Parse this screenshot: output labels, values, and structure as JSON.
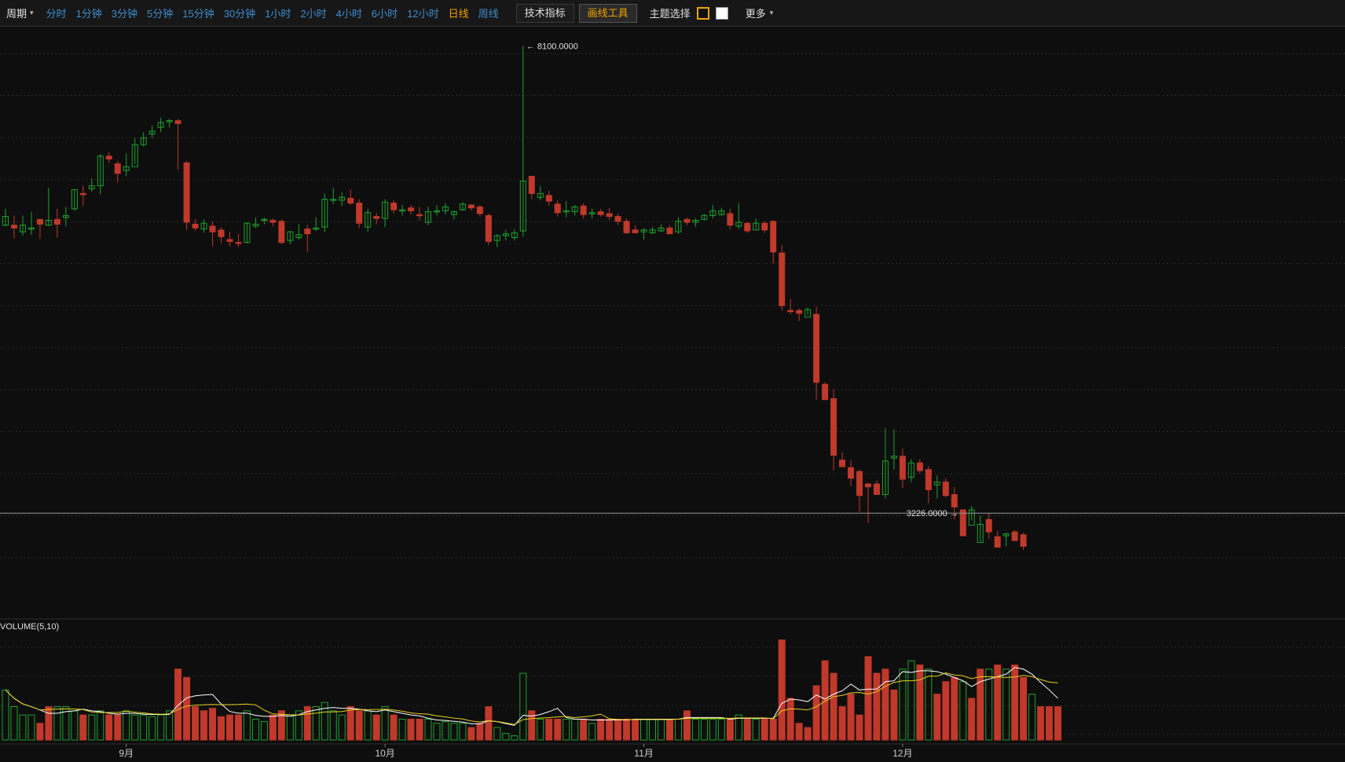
{
  "toolbar": {
    "period_label": "周期",
    "caret": "▾",
    "intervals": [
      "分时",
      "1分钟",
      "3分钟",
      "5分钟",
      "15分钟",
      "30分钟",
      "1小时",
      "2小时",
      "4小时",
      "6小时",
      "12小时",
      "日线",
      "周线"
    ],
    "active_interval": "日线",
    "indicators_label": "技术指标",
    "drawing_tools_label": "画线工具",
    "theme_label": "主题选择",
    "more_label": "更多"
  },
  "colors": {
    "up": "#1fa32e",
    "down": "#c0392b",
    "ma5": "#ffffff",
    "ma10": "#e8d21e",
    "accent": "#f0a500",
    "link": "#3d8fd1"
  },
  "chart_data": {
    "type": "candlestick",
    "price_ylim": [
      2400,
      8300
    ],
    "high_annotation": "8100.0000",
    "low_annotation": "3226.0000",
    "volume_label": "VOLUME(5,10)",
    "month_labels": [
      {
        "index": 14,
        "label": "9月"
      },
      {
        "index": 44,
        "label": "10月"
      },
      {
        "index": 74,
        "label": "11月"
      },
      {
        "index": 104,
        "label": "12月"
      }
    ],
    "candles": [
      [
        6320,
        6400,
        6220,
        6230,
        "up"
      ],
      [
        6200,
        6330,
        6090,
        6230,
        "down"
      ],
      [
        6230,
        6330,
        6120,
        6160,
        "up"
      ],
      [
        6190,
        6370,
        6130,
        6200,
        "up"
      ],
      [
        6240,
        6260,
        6090,
        6290,
        "down"
      ],
      [
        6230,
        6620,
        6220,
        6280,
        "up"
      ],
      [
        6240,
        6400,
        6100,
        6290,
        "down"
      ],
      [
        6330,
        6420,
        6220,
        6310,
        "up"
      ],
      [
        6400,
        6600,
        6380,
        6600,
        "up"
      ],
      [
        6560,
        6640,
        6430,
        6550,
        "down"
      ],
      [
        6610,
        6720,
        6580,
        6640,
        "up"
      ],
      [
        6950,
        6970,
        6550,
        6640,
        "up"
      ],
      [
        6920,
        6990,
        6880,
        6950,
        "down"
      ],
      [
        6770,
        6900,
        6680,
        6870,
        "down"
      ],
      [
        6840,
        6980,
        6740,
        6800,
        "up"
      ],
      [
        7070,
        7140,
        6870,
        6840,
        "up"
      ],
      [
        7140,
        7200,
        7050,
        7070,
        "up"
      ],
      [
        7210,
        7270,
        7140,
        7180,
        "up"
      ],
      [
        7300,
        7350,
        7200,
        7250,
        "up"
      ],
      [
        7320,
        7340,
        7250,
        7310,
        "up"
      ],
      [
        7320,
        7340,
        6810,
        7290,
        "down"
      ],
      [
        6880,
        6900,
        6180,
        6260,
        "down"
      ],
      [
        6200,
        6290,
        6170,
        6240,
        "down"
      ],
      [
        6250,
        6290,
        6150,
        6190,
        "up"
      ],
      [
        6220,
        6270,
        6010,
        6160,
        "down"
      ],
      [
        6180,
        6210,
        6040,
        6110,
        "down"
      ],
      [
        6080,
        6160,
        6010,
        6060,
        "down"
      ],
      [
        6050,
        6140,
        6000,
        6040,
        "down"
      ],
      [
        6050,
        6260,
        6040,
        6250,
        "up"
      ],
      [
        6240,
        6310,
        6200,
        6220,
        "up"
      ],
      [
        6280,
        6310,
        6240,
        6290,
        "up"
      ],
      [
        6280,
        6300,
        6220,
        6260,
        "down"
      ],
      [
        6270,
        6290,
        6030,
        6050,
        "down"
      ],
      [
        6070,
        6170,
        6030,
        6160,
        "up"
      ],
      [
        6130,
        6240,
        6080,
        6100,
        "up"
      ],
      [
        6190,
        6230,
        5950,
        6140,
        "down"
      ],
      [
        6200,
        6310,
        6170,
        6200,
        "up"
      ],
      [
        6500,
        6560,
        6160,
        6210,
        "up"
      ],
      [
        6500,
        6620,
        6450,
        6490,
        "up"
      ],
      [
        6490,
        6570,
        6430,
        6520,
        "up"
      ],
      [
        6510,
        6600,
        6440,
        6460,
        "down"
      ],
      [
        6460,
        6500,
        6200,
        6250,
        "down"
      ],
      [
        6210,
        6400,
        6160,
        6360,
        "up"
      ],
      [
        6320,
        6360,
        6240,
        6300,
        "down"
      ],
      [
        6300,
        6500,
        6210,
        6470,
        "up"
      ],
      [
        6460,
        6490,
        6350,
        6390,
        "down"
      ],
      [
        6390,
        6440,
        6330,
        6380,
        "up"
      ],
      [
        6410,
        6440,
        6340,
        6380,
        "down"
      ],
      [
        6340,
        6420,
        6280,
        6330,
        "down"
      ],
      [
        6260,
        6420,
        6230,
        6370,
        "up"
      ],
      [
        6370,
        6440,
        6330,
        6380,
        "up"
      ],
      [
        6420,
        6460,
        6340,
        6380,
        "up"
      ],
      [
        6370,
        6380,
        6290,
        6340,
        "up"
      ],
      [
        6450,
        6470,
        6380,
        6390,
        "up"
      ],
      [
        6440,
        6450,
        6380,
        6410,
        "down"
      ],
      [
        6420,
        6440,
        6320,
        6350,
        "down"
      ],
      [
        6330,
        6350,
        6020,
        6060,
        "down"
      ],
      [
        6120,
        6140,
        6000,
        6070,
        "up"
      ],
      [
        6140,
        6180,
        6070,
        6120,
        "up"
      ],
      [
        6150,
        6190,
        6070,
        6100,
        "up"
      ],
      [
        6690,
        8100,
        6110,
        6170,
        "up"
      ],
      [
        6740,
        6740,
        6500,
        6560,
        "down"
      ],
      [
        6560,
        6640,
        6490,
        6520,
        "up"
      ],
      [
        6540,
        6590,
        6430,
        6480,
        "down"
      ],
      [
        6450,
        6490,
        6320,
        6360,
        "down"
      ],
      [
        6380,
        6480,
        6310,
        6370,
        "up"
      ],
      [
        6420,
        6440,
        6330,
        6370,
        "up"
      ],
      [
        6430,
        6460,
        6300,
        6340,
        "down"
      ],
      [
        6360,
        6400,
        6300,
        6360,
        "up"
      ],
      [
        6370,
        6400,
        6320,
        6340,
        "down"
      ],
      [
        6350,
        6410,
        6280,
        6320,
        "down"
      ],
      [
        6320,
        6350,
        6230,
        6270,
        "down"
      ],
      [
        6270,
        6300,
        6140,
        6150,
        "down"
      ],
      [
        6180,
        6230,
        6150,
        6150,
        "down"
      ],
      [
        6180,
        6200,
        6080,
        6160,
        "up"
      ],
      [
        6180,
        6210,
        6140,
        6150,
        "up"
      ],
      [
        6200,
        6240,
        6160,
        6170,
        "up"
      ],
      [
        6200,
        6230,
        6180,
        6140,
        "down"
      ],
      [
        6270,
        6310,
        6140,
        6160,
        "up"
      ],
      [
        6290,
        6310,
        6230,
        6260,
        "down"
      ],
      [
        6280,
        6300,
        6210,
        6260,
        "up"
      ],
      [
        6330,
        6350,
        6280,
        6290,
        "up"
      ],
      [
        6380,
        6440,
        6300,
        6330,
        "up"
      ],
      [
        6380,
        6410,
        6330,
        6340,
        "up"
      ],
      [
        6350,
        6400,
        6190,
        6230,
        "down"
      ],
      [
        6260,
        6460,
        6190,
        6220,
        "up"
      ],
      [
        6250,
        6260,
        6150,
        6170,
        "down"
      ],
      [
        6250,
        6300,
        6190,
        6180,
        "up"
      ],
      [
        6250,
        6270,
        6150,
        6180,
        "down"
      ],
      [
        6270,
        6280,
        5830,
        5950,
        "down"
      ],
      [
        5940,
        6020,
        5340,
        5390,
        "down"
      ],
      [
        5340,
        5460,
        5300,
        5340,
        "down"
      ],
      [
        5340,
        5360,
        5230,
        5310,
        "down"
      ],
      [
        5350,
        5370,
        5290,
        5270,
        "up"
      ],
      [
        5300,
        5380,
        4410,
        4590,
        "down"
      ],
      [
        4570,
        4590,
        4410,
        4410,
        "down"
      ],
      [
        4420,
        4520,
        3670,
        3830,
        "down"
      ],
      [
        3780,
        3860,
        3710,
        3710,
        "down"
      ],
      [
        3700,
        3780,
        3510,
        3590,
        "down"
      ],
      [
        3660,
        3680,
        3240,
        3410,
        "down"
      ],
      [
        3500,
        3540,
        3120,
        3530,
        "down"
      ],
      [
        3530,
        3570,
        3480,
        3420,
        "down"
      ],
      [
        3770,
        4110,
        3380,
        3420,
        "up"
      ],
      [
        3820,
        4100,
        3680,
        3800,
        "up"
      ],
      [
        3820,
        3900,
        3490,
        3580,
        "down"
      ],
      [
        3600,
        3790,
        3550,
        3750,
        "up"
      ],
      [
        3750,
        3790,
        3640,
        3670,
        "down"
      ],
      [
        3680,
        3720,
        3330,
        3470,
        "down"
      ],
      [
        3550,
        3620,
        3380,
        3520,
        "up"
      ],
      [
        3550,
        3590,
        3390,
        3410,
        "down"
      ],
      [
        3420,
        3500,
        3160,
        3290,
        "down"
      ],
      [
        2990,
        3000,
        2990,
        3260,
        "down"
      ],
      [
        3260,
        3300,
        3150,
        3100,
        "up"
      ],
      [
        3110,
        3200,
        2930,
        2920,
        "up"
      ],
      [
        3160,
        3230,
        2960,
        3030,
        "down"
      ],
      [
        2980,
        3040,
        2940,
        2870,
        "down"
      ],
      [
        2990,
        3020,
        2880,
        3010,
        "up"
      ],
      [
        3030,
        3050,
        2950,
        2940,
        "down"
      ],
      [
        3000,
        3020,
        2840,
        2880,
        "down"
      ]
    ],
    "volume_ylim": [
      0,
      130
    ],
    "volumes": [
      [
        60,
        "up"
      ],
      [
        40,
        "up"
      ],
      [
        30,
        "up"
      ],
      [
        30,
        "up"
      ],
      [
        20,
        "down"
      ],
      [
        40,
        "down"
      ],
      [
        40,
        "up"
      ],
      [
        40,
        "up"
      ],
      [
        35,
        "up"
      ],
      [
        30,
        "down"
      ],
      [
        30,
        "up"
      ],
      [
        35,
        "up"
      ],
      [
        30,
        "down"
      ],
      [
        30,
        "down"
      ],
      [
        35,
        "up"
      ],
      [
        30,
        "up"
      ],
      [
        30,
        "up"
      ],
      [
        28,
        "up"
      ],
      [
        30,
        "up"
      ],
      [
        35,
        "up"
      ],
      [
        85,
        "down"
      ],
      [
        75,
        "down"
      ],
      [
        40,
        "down"
      ],
      [
        35,
        "down"
      ],
      [
        38,
        "down"
      ],
      [
        28,
        "down"
      ],
      [
        30,
        "down"
      ],
      [
        30,
        "down"
      ],
      [
        35,
        "up"
      ],
      [
        25,
        "up"
      ],
      [
        22,
        "up"
      ],
      [
        30,
        "down"
      ],
      [
        35,
        "down"
      ],
      [
        30,
        "up"
      ],
      [
        35,
        "up"
      ],
      [
        40,
        "down"
      ],
      [
        40,
        "up"
      ],
      [
        45,
        "up"
      ],
      [
        35,
        "up"
      ],
      [
        30,
        "up"
      ],
      [
        40,
        "down"
      ],
      [
        35,
        "down"
      ],
      [
        35,
        "up"
      ],
      [
        30,
        "down"
      ],
      [
        40,
        "up"
      ],
      [
        30,
        "down"
      ],
      [
        25,
        "up"
      ],
      [
        25,
        "down"
      ],
      [
        25,
        "down"
      ],
      [
        25,
        "up"
      ],
      [
        20,
        "up"
      ],
      [
        22,
        "up"
      ],
      [
        20,
        "up"
      ],
      [
        20,
        "up"
      ],
      [
        15,
        "down"
      ],
      [
        20,
        "down"
      ],
      [
        40,
        "down"
      ],
      [
        15,
        "up"
      ],
      [
        8,
        "up"
      ],
      [
        5,
        "up"
      ],
      [
        80,
        "up"
      ],
      [
        35,
        "down"
      ],
      [
        25,
        "up"
      ],
      [
        25,
        "down"
      ],
      [
        25,
        "down"
      ],
      [
        25,
        "up"
      ],
      [
        25,
        "up"
      ],
      [
        25,
        "down"
      ],
      [
        20,
        "up"
      ],
      [
        25,
        "down"
      ],
      [
        25,
        "down"
      ],
      [
        25,
        "down"
      ],
      [
        25,
        "down"
      ],
      [
        25,
        "down"
      ],
      [
        25,
        "up"
      ],
      [
        25,
        "up"
      ],
      [
        25,
        "up"
      ],
      [
        25,
        "down"
      ],
      [
        25,
        "up"
      ],
      [
        35,
        "down"
      ],
      [
        25,
        "up"
      ],
      [
        25,
        "up"
      ],
      [
        25,
        "up"
      ],
      [
        25,
        "up"
      ],
      [
        25,
        "down"
      ],
      [
        30,
        "up"
      ],
      [
        25,
        "down"
      ],
      [
        25,
        "up"
      ],
      [
        25,
        "down"
      ],
      [
        25,
        "down"
      ],
      [
        120,
        "down"
      ],
      [
        50,
        "down"
      ],
      [
        20,
        "down"
      ],
      [
        15,
        "down"
      ],
      [
        65,
        "down"
      ],
      [
        95,
        "down"
      ],
      [
        80,
        "down"
      ],
      [
        40,
        "down"
      ],
      [
        55,
        "down"
      ],
      [
        30,
        "down"
      ],
      [
        100,
        "down"
      ],
      [
        80,
        "down"
      ],
      [
        85,
        "down"
      ],
      [
        60,
        "down"
      ],
      [
        85,
        "up"
      ],
      [
        95,
        "up"
      ],
      [
        90,
        "down"
      ],
      [
        85,
        "up"
      ],
      [
        55,
        "down"
      ],
      [
        70,
        "down"
      ],
      [
        75,
        "down"
      ],
      [
        70,
        "up"
      ],
      [
        50,
        "down"
      ],
      [
        85,
        "down"
      ],
      [
        85,
        "up"
      ],
      [
        90,
        "down"
      ],
      [
        85,
        "up"
      ],
      [
        90,
        "down"
      ],
      [
        75,
        "down"
      ],
      [
        55,
        "up"
      ],
      [
        40,
        "down"
      ],
      [
        40,
        "down"
      ],
      [
        40,
        "down"
      ]
    ]
  }
}
